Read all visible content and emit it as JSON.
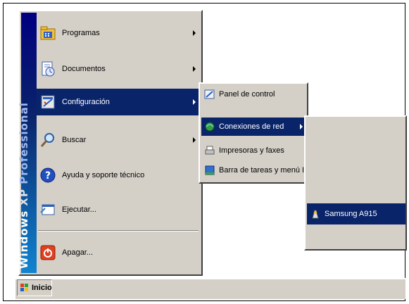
{
  "start_menu": {
    "banner": {
      "part1": "Windows",
      "part2": "XP",
      "part3": "Professional"
    },
    "items": [
      {
        "label": "Programas",
        "icon": "programs-folder-icon",
        "has_submenu": true
      },
      {
        "label": "Documentos",
        "icon": "documents-icon",
        "has_submenu": true
      },
      {
        "label": "Configuración",
        "icon": "settings-icon",
        "has_submenu": true
      },
      {
        "label": "Buscar",
        "icon": "search-icon",
        "has_submenu": true
      },
      {
        "label": "Ayuda y soporte técnico",
        "icon": "help-icon",
        "has_submenu": false
      },
      {
        "label": "Ejecutar...",
        "icon": "run-icon",
        "has_submenu": false
      },
      {
        "label": "Apagar...",
        "icon": "shutdown-icon",
        "has_submenu": false
      }
    ]
  },
  "settings_submenu": {
    "items": [
      {
        "label": "Panel de control",
        "icon": "control-panel-icon"
      },
      {
        "label": "Conexiones de red",
        "icon": "network-connections-icon",
        "has_submenu": true
      },
      {
        "label": "Impresoras y faxes",
        "icon": "printers-icon"
      },
      {
        "label": "Barra de tareas y menú Inicio",
        "icon": "taskbar-icon"
      }
    ]
  },
  "network_submenu": {
    "items": [
      {
        "label": "Samsung A915",
        "icon": "modem-connection-icon"
      }
    ]
  },
  "taskbar": {
    "start_label": "Inicio"
  },
  "colors": {
    "highlight": "#0a246a",
    "menu_bg": "#d4d0c8",
    "banner": "#000080"
  }
}
